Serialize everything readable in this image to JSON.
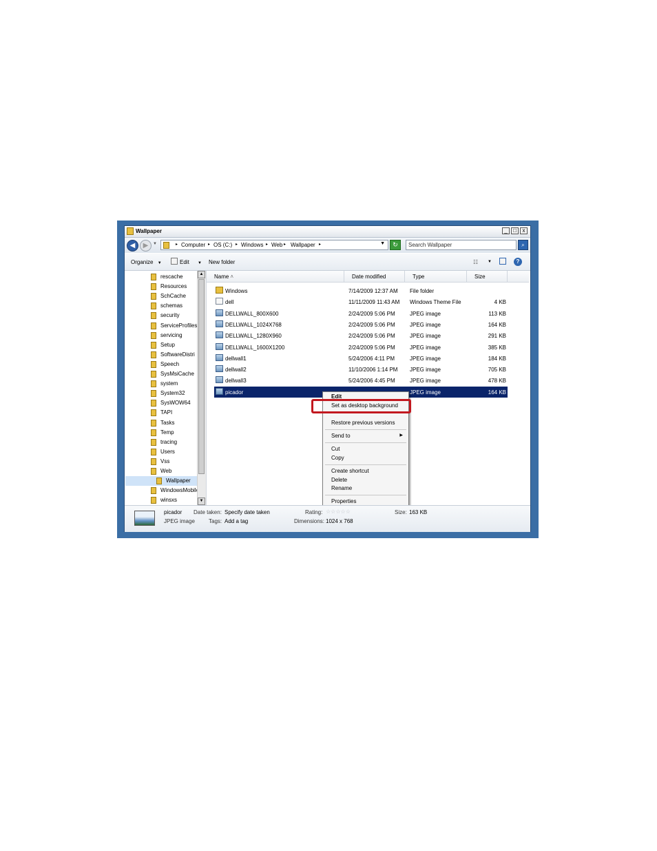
{
  "window": {
    "title": "Wallpaper",
    "controls": {
      "minimize": "_",
      "maximize": "□",
      "close": "x"
    }
  },
  "address": {
    "crumbs": [
      "Computer",
      "OS (C:)",
      "Windows",
      "Web",
      "Wallpaper"
    ],
    "separator": "▸",
    "search_placeholder": "Search Wallpaper"
  },
  "toolbar": {
    "organize": "Organize",
    "edit": "Edit",
    "new_folder": "New folder"
  },
  "nav": {
    "items": [
      "rescache",
      "Resources",
      "SchCache",
      "schemas",
      "security",
      "ServiceProfiles",
      "servicing",
      "Setup",
      "SoftwareDistri",
      "Speech",
      "SysMsiCache",
      "system",
      "System32",
      "SysWOW64",
      "TAPI",
      "Tasks",
      "Temp",
      "tracing",
      "Users",
      "Vss",
      "Web",
      "Wallpaper",
      "WindowsMobile",
      "winsxs"
    ],
    "selected": "Wallpaper"
  },
  "columns": {
    "name": "Name",
    "date": "Date modified",
    "type": "Type",
    "size": "Size"
  },
  "files": [
    {
      "name": "Windows",
      "date": "7/14/2009 12:37 AM",
      "type": "File folder",
      "size": "",
      "icon": "folder-icon"
    },
    {
      "name": "dell",
      "date": "11/11/2009 11:43 AM",
      "type": "Windows Theme File",
      "size": "4 KB",
      "icon": "theme-file-icon"
    },
    {
      "name": "DELLWALL_800X600",
      "date": "2/24/2009 5:06 PM",
      "type": "JPEG image",
      "size": "113 KB",
      "icon": "jpeg-icon"
    },
    {
      "name": "DELLWALL_1024X768",
      "date": "2/24/2009 5:06 PM",
      "type": "JPEG image",
      "size": "164 KB",
      "icon": "jpeg-icon"
    },
    {
      "name": "DELLWALL_1280X960",
      "date": "2/24/2009 5:06 PM",
      "type": "JPEG image",
      "size": "291 KB",
      "icon": "jpeg-icon"
    },
    {
      "name": "DELLWALL_1600X1200",
      "date": "2/24/2009 5:06 PM",
      "type": "JPEG image",
      "size": "385 KB",
      "icon": "jpeg-icon"
    },
    {
      "name": "dellwall1",
      "date": "5/24/2006 4:11 PM",
      "type": "JPEG image",
      "size": "184 KB",
      "icon": "jpeg-icon"
    },
    {
      "name": "dellwall2",
      "date": "11/10/2006 1:14 PM",
      "type": "JPEG image",
      "size": "705 KB",
      "icon": "jpeg-icon"
    },
    {
      "name": "dellwall3",
      "date": "5/24/2006 4:45 PM",
      "type": "JPEG image",
      "size": "478 KB",
      "icon": "jpeg-icon"
    },
    {
      "name": "picador",
      "date": "",
      "type": "JPEG image",
      "size": "164 KB",
      "icon": "jpeg-icon",
      "selected": true
    }
  ],
  "context_menu": {
    "edit": "Edit",
    "set_background": "Set as desktop background",
    "restore": "Restore previous versions",
    "send_to": "Send to",
    "cut": "Cut",
    "copy": "Copy",
    "create_shortcut": "Create shortcut",
    "delete": "Delete",
    "rename": "Rename",
    "properties": "Properties"
  },
  "details": {
    "name": "picador",
    "type": "JPEG image",
    "date_taken_label": "Date taken:",
    "date_taken_value": "Specify date taken",
    "tags_label": "Tags:",
    "tags_value": "Add a tag",
    "rating_label": "Rating:",
    "rating_stars": "☆☆☆☆☆",
    "dimensions_label": "Dimensions:",
    "dimensions_value": "1024 x 768",
    "size_label": "Size:",
    "size_value": "163 KB"
  },
  "colors": {
    "frame": "#3b6ea5",
    "selection": "#0a246a",
    "highlight_box": "#c2181f"
  }
}
